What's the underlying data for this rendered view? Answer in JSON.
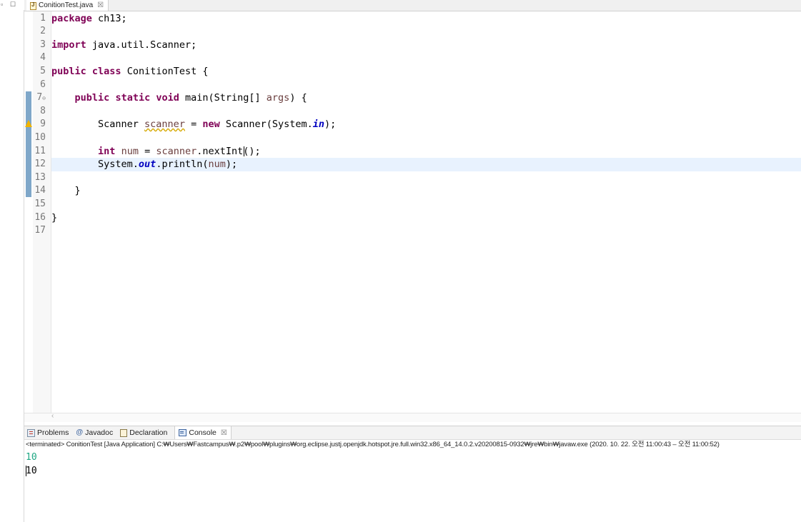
{
  "editor": {
    "tab": {
      "title": "ConitionTest.java",
      "close": "☒"
    },
    "lines": [
      {
        "n": "1",
        "segments": [
          {
            "t": "package",
            "c": "kw"
          },
          {
            "t": " ch13;"
          }
        ]
      },
      {
        "n": "2",
        "segments": []
      },
      {
        "n": "3",
        "segments": [
          {
            "t": "import",
            "c": "kw"
          },
          {
            "t": " java.util.Scanner;"
          }
        ]
      },
      {
        "n": "4",
        "segments": []
      },
      {
        "n": "5",
        "segments": [
          {
            "t": "public",
            "c": "kw"
          },
          {
            "t": " "
          },
          {
            "t": "class",
            "c": "kw"
          },
          {
            "t": " ConitionTest {"
          }
        ]
      },
      {
        "n": "6",
        "segments": []
      },
      {
        "n": "7",
        "fold": true,
        "segments": [
          {
            "t": "    "
          },
          {
            "t": "public",
            "c": "kw"
          },
          {
            "t": " "
          },
          {
            "t": "static",
            "c": "kw"
          },
          {
            "t": " "
          },
          {
            "t": "void",
            "c": "kw"
          },
          {
            "t": " main(String[] "
          },
          {
            "t": "args",
            "c": "param"
          },
          {
            "t": ") {"
          }
        ]
      },
      {
        "n": "8",
        "segments": []
      },
      {
        "n": "9",
        "warning": true,
        "segments": [
          {
            "t": "        Scanner "
          },
          {
            "t": "scanner",
            "c": "param warn-ul"
          },
          {
            "t": " = "
          },
          {
            "t": "new",
            "c": "kw"
          },
          {
            "t": " Scanner(System."
          },
          {
            "t": "in",
            "c": "static-f"
          },
          {
            "t": ");"
          }
        ]
      },
      {
        "n": "10",
        "segments": []
      },
      {
        "n": "11",
        "segments": [
          {
            "t": "        "
          },
          {
            "t": "int",
            "c": "kw"
          },
          {
            "t": " "
          },
          {
            "t": "num",
            "c": "param"
          },
          {
            "t": " = "
          },
          {
            "t": "scanner",
            "c": "param"
          },
          {
            "t": ".nextInt();"
          }
        ]
      },
      {
        "n": "12",
        "current": true,
        "segments": [
          {
            "t": "        System."
          },
          {
            "t": "out",
            "c": "static-f"
          },
          {
            "t": ".println("
          },
          {
            "t": "num",
            "c": "param"
          },
          {
            "t": ");"
          }
        ]
      },
      {
        "n": "13",
        "segments": []
      },
      {
        "n": "14",
        "segments": [
          {
            "t": "    }"
          }
        ]
      },
      {
        "n": "15",
        "segments": []
      },
      {
        "n": "16",
        "segments": [
          {
            "t": "}"
          }
        ]
      },
      {
        "n": "17",
        "segments": []
      }
    ]
  },
  "panel": {
    "tabs": [
      {
        "label": "Problems",
        "icon": "problems-icon",
        "active": false
      },
      {
        "label": "Javadoc",
        "icon": "javadoc-icon",
        "active": false
      },
      {
        "label": "Declaration",
        "icon": "declaration-icon",
        "active": false
      },
      {
        "label": "Console",
        "icon": "console-icon",
        "active": true,
        "close": "☒"
      }
    ],
    "console_header": "<terminated> ConitionTest [Java Application] C:₩Users₩Fastcampus₩.p2₩pool₩plugins₩org.eclipse.justj.openjdk.hotspot.jre.full.win32.x86_64_14.0.2.v20200815-0932₩jre₩bin₩javaw.exe  (2020. 10. 22. 오전 11:00:43 – 오전 11:00:52)",
    "output": [
      {
        "text": "10",
        "kind": "input"
      },
      {
        "text": "10",
        "kind": "stdout"
      }
    ]
  },
  "colors": {
    "keyword": "#7f0055",
    "local_var": "#6a3e3e",
    "static_field": "#0000c0",
    "console_input": "#1fa783",
    "current_line": "#e8f2fe"
  }
}
